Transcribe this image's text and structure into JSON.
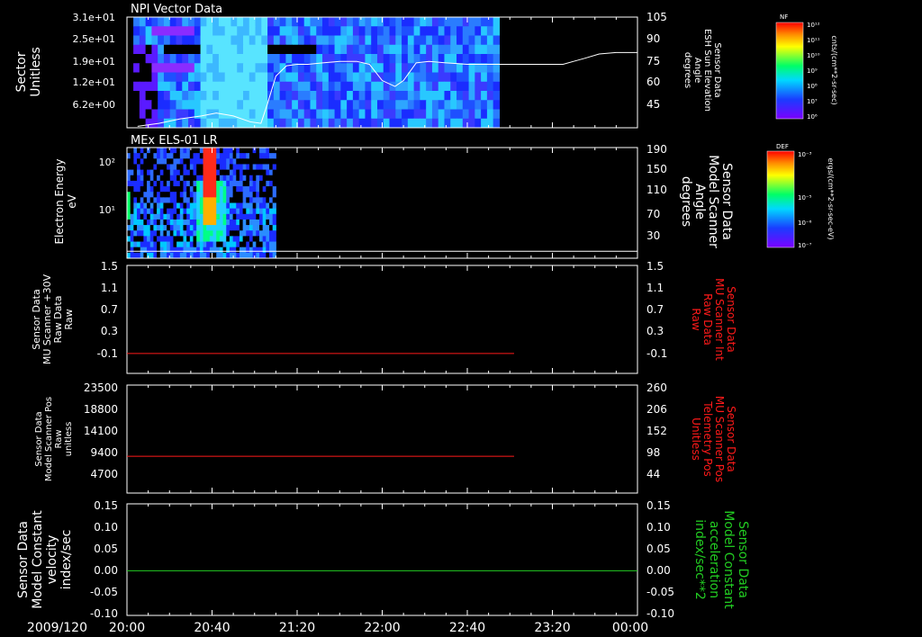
{
  "date_label": "2009/120",
  "time_axis": {
    "ticks": [
      "20:00",
      "20:40",
      "21:20",
      "22:00",
      "22:40",
      "23:20",
      "00:00"
    ],
    "range_minutes": [
      0,
      240
    ],
    "major_step_minutes": 40,
    "minor_step_minutes": 10
  },
  "colors": {
    "background": "#000000",
    "axis": "#ffffff",
    "red_trace": "#ff1a1a",
    "green_trace": "#22cc22"
  },
  "chart_data": [
    {
      "type": "heatmap",
      "title": "NPI Vector Data",
      "ylabel_left": [
        "Sector",
        "Unitless"
      ],
      "yticks_left": [
        "3.1e+01",
        "2.5e+01",
        "1.9e+01",
        "1.2e+01",
        "6.2e+00"
      ],
      "ylabel_right": [
        "Sensor Data",
        "ESH Sun Elevation",
        "Angle",
        "degrees"
      ],
      "yticks_right": [
        "105",
        "90",
        "75",
        "60",
        "45"
      ],
      "ylim_right": [
        30,
        105
      ],
      "data_extent_minutes": [
        3,
        175
      ],
      "overlay_line": {
        "color": "#ffffff",
        "x_minutes": [
          5,
          15,
          25,
          35,
          42,
          50,
          58,
          63,
          66,
          70,
          75,
          80,
          85,
          92,
          100,
          108,
          114,
          120,
          126,
          130,
          136,
          142,
          150,
          160,
          175,
          190,
          205,
          210,
          215,
          222,
          230,
          240
        ],
        "y": [
          31,
          33,
          36,
          38,
          40,
          38,
          34,
          33,
          46,
          65,
          72,
          73,
          73,
          74,
          75,
          75,
          73,
          62,
          58,
          62,
          74,
          75,
          74,
          73,
          73,
          73,
          73,
          75,
          77,
          80,
          81,
          81
        ]
      },
      "colorbar": {
        "label": "NF",
        "unit": "cnts/(cm**2-sr-sec)",
        "ticks": [
          "10¹²",
          "10¹¹",
          "10¹⁰",
          "10⁹",
          "10⁸",
          "10⁷",
          "10⁶"
        ]
      }
    },
    {
      "type": "heatmap",
      "title": "MEx ELS-01 LR",
      "ylabel_left": [
        "Electron Energy",
        "eV"
      ],
      "yticks_left": [
        "10²",
        "10¹"
      ],
      "ylabel_right": [
        "Sensor Data",
        "Model Scanner",
        "Angle",
        "degrees"
      ],
      "yticks_right": [
        "190",
        "150",
        "110",
        "70",
        "30"
      ],
      "ylim_right": [
        0,
        190
      ],
      "data_extent_minutes": [
        0,
        70
      ],
      "overlay_line": {
        "color": "#ffffff",
        "x_minutes": [
          0,
          240
        ],
        "y": [
          12,
          12
        ]
      },
      "colorbar": {
        "label": "DEF",
        "unit": "ergs/(cm**2-sr-sec-eV)",
        "ticks": [
          "10⁻³",
          "10⁻⁵",
          "10⁻⁶",
          "10⁻⁷"
        ]
      }
    },
    {
      "type": "line",
      "ylabel_left": [
        "Sensor Data",
        "MU Scanner +30V",
        "Raw Data",
        "Raw"
      ],
      "yticks_left": [
        "1.5",
        "1.1",
        "0.7",
        "0.3",
        "-0.1"
      ],
      "ylabel_right": [
        "Sensor Data",
        "MU Scanner Int",
        "Raw Data",
        "Raw"
      ],
      "yticks_right": [
        "1.5",
        "1.1",
        "0.7",
        "0.3",
        "-0.1"
      ],
      "ylim": [
        -0.4,
        1.5
      ],
      "right_label_color": "#ff1a1a",
      "series": [
        {
          "color": "#ff1a1a",
          "x_minutes": [
            0,
            182
          ],
          "y": [
            -0.05,
            -0.05
          ]
        }
      ]
    },
    {
      "type": "line",
      "ylabel_left": [
        "Sensor Data",
        "Model Scanner Pos",
        "Raw",
        "unitless"
      ],
      "yticks_left": [
        "23500",
        "18800",
        "14100",
        "9400",
        "4700"
      ],
      "ylabel_right": [
        "Sensor Data",
        "MU Scanner Pos",
        "Telemetry Pos",
        "Unitless"
      ],
      "yticks_right": [
        "260",
        "206",
        "152",
        "98",
        "44"
      ],
      "ylim": [
        0,
        23500
      ],
      "right_label_color": "#ff1a1a",
      "series": [
        {
          "color": "#ff1a1a",
          "x_minutes": [
            0,
            182
          ],
          "y": [
            8000,
            8000
          ]
        }
      ]
    },
    {
      "type": "line",
      "ylabel_left": [
        "Sensor Data",
        "Model Constant",
        "velocity",
        "index/sec"
      ],
      "yticks_left": [
        "0.15",
        "0.10",
        "0.05",
        "0.00",
        "-0.05",
        "-0.10"
      ],
      "ylabel_right": [
        "Sensor Data",
        "Model Constant",
        "acceleration",
        "index/sec**2"
      ],
      "yticks_right": [
        "0.15",
        "0.10",
        "0.05",
        "0.00",
        "-0.05",
        "-0.10"
      ],
      "ylim": [
        -0.1,
        0.15
      ],
      "right_label_color": "#22cc22",
      "series": [
        {
          "color": "#22cc22",
          "x_minutes": [
            0,
            240
          ],
          "y": [
            0,
            0
          ]
        }
      ]
    }
  ]
}
